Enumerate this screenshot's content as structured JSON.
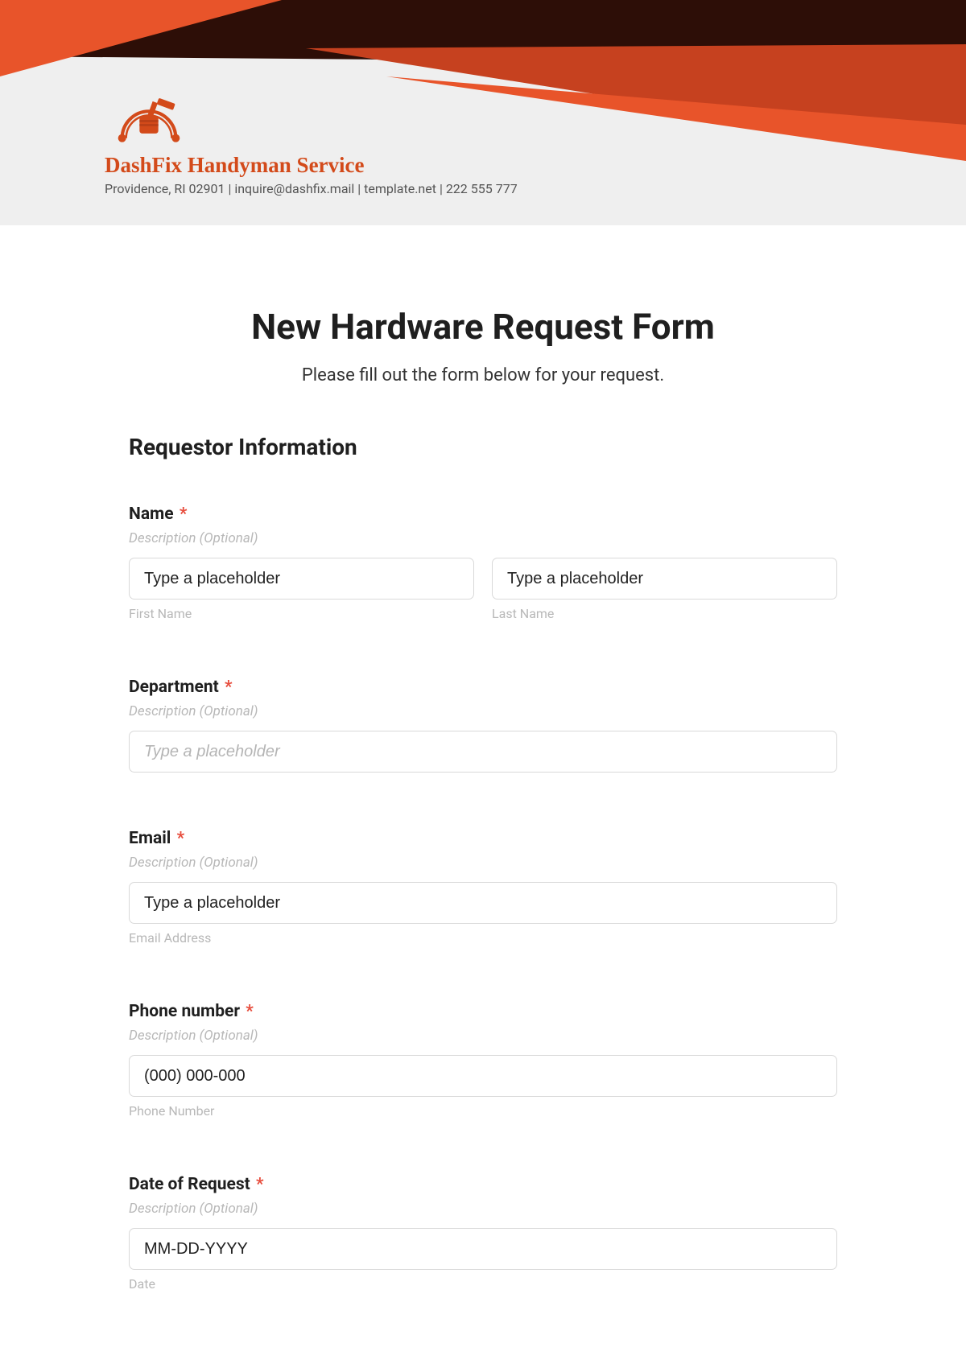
{
  "brand": {
    "name": "DashFix Handyman Service",
    "subline": "Providence, RI 02901 | inquire@dashfix.mail | template.net | 222 555 777"
  },
  "form": {
    "title": "New Hardware Request Form",
    "subtitle": "Please fill out the form below for your request.",
    "section1": "Requestor Information",
    "desc_placeholder": "Description (Optional)",
    "common_placeholder": "Type a placeholder",
    "fields": {
      "name": {
        "label": "Name",
        "first_sub": "First Name",
        "last_sub": "Last Name",
        "first_value": "Type a placeholder",
        "last_value": "Type a placeholder"
      },
      "department": {
        "label": "Department"
      },
      "email": {
        "label": "Email",
        "sub": "Email Address",
        "value": "Type a placeholder"
      },
      "phone": {
        "label": "Phone number",
        "sub": "Phone Number",
        "value": "(000) 000-000"
      },
      "date": {
        "label": "Date of Request",
        "sub": "Date",
        "value": "MM-DD-YYYY"
      }
    }
  },
  "colors": {
    "accent": "#d34a1a",
    "dark": "#2d0e07",
    "orange_mid": "#c6411f",
    "orange_bright": "#e8542a"
  }
}
